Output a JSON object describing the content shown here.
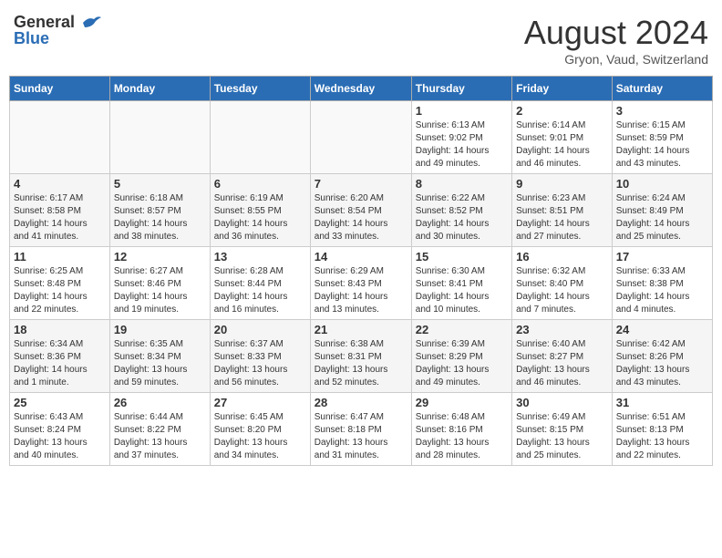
{
  "header": {
    "logo_general": "General",
    "logo_blue": "Blue",
    "title": "August 2024",
    "location": "Gryon, Vaud, Switzerland"
  },
  "weekdays": [
    "Sunday",
    "Monday",
    "Tuesday",
    "Wednesday",
    "Thursday",
    "Friday",
    "Saturday"
  ],
  "weeks": [
    [
      {
        "day": "",
        "info": ""
      },
      {
        "day": "",
        "info": ""
      },
      {
        "day": "",
        "info": ""
      },
      {
        "day": "",
        "info": ""
      },
      {
        "day": "1",
        "info": "Sunrise: 6:13 AM\nSunset: 9:02 PM\nDaylight: 14 hours\nand 49 minutes."
      },
      {
        "day": "2",
        "info": "Sunrise: 6:14 AM\nSunset: 9:01 PM\nDaylight: 14 hours\nand 46 minutes."
      },
      {
        "day": "3",
        "info": "Sunrise: 6:15 AM\nSunset: 8:59 PM\nDaylight: 14 hours\nand 43 minutes."
      }
    ],
    [
      {
        "day": "4",
        "info": "Sunrise: 6:17 AM\nSunset: 8:58 PM\nDaylight: 14 hours\nand 41 minutes."
      },
      {
        "day": "5",
        "info": "Sunrise: 6:18 AM\nSunset: 8:57 PM\nDaylight: 14 hours\nand 38 minutes."
      },
      {
        "day": "6",
        "info": "Sunrise: 6:19 AM\nSunset: 8:55 PM\nDaylight: 14 hours\nand 36 minutes."
      },
      {
        "day": "7",
        "info": "Sunrise: 6:20 AM\nSunset: 8:54 PM\nDaylight: 14 hours\nand 33 minutes."
      },
      {
        "day": "8",
        "info": "Sunrise: 6:22 AM\nSunset: 8:52 PM\nDaylight: 14 hours\nand 30 minutes."
      },
      {
        "day": "9",
        "info": "Sunrise: 6:23 AM\nSunset: 8:51 PM\nDaylight: 14 hours\nand 27 minutes."
      },
      {
        "day": "10",
        "info": "Sunrise: 6:24 AM\nSunset: 8:49 PM\nDaylight: 14 hours\nand 25 minutes."
      }
    ],
    [
      {
        "day": "11",
        "info": "Sunrise: 6:25 AM\nSunset: 8:48 PM\nDaylight: 14 hours\nand 22 minutes."
      },
      {
        "day": "12",
        "info": "Sunrise: 6:27 AM\nSunset: 8:46 PM\nDaylight: 14 hours\nand 19 minutes."
      },
      {
        "day": "13",
        "info": "Sunrise: 6:28 AM\nSunset: 8:44 PM\nDaylight: 14 hours\nand 16 minutes."
      },
      {
        "day": "14",
        "info": "Sunrise: 6:29 AM\nSunset: 8:43 PM\nDaylight: 14 hours\nand 13 minutes."
      },
      {
        "day": "15",
        "info": "Sunrise: 6:30 AM\nSunset: 8:41 PM\nDaylight: 14 hours\nand 10 minutes."
      },
      {
        "day": "16",
        "info": "Sunrise: 6:32 AM\nSunset: 8:40 PM\nDaylight: 14 hours\nand 7 minutes."
      },
      {
        "day": "17",
        "info": "Sunrise: 6:33 AM\nSunset: 8:38 PM\nDaylight: 14 hours\nand 4 minutes."
      }
    ],
    [
      {
        "day": "18",
        "info": "Sunrise: 6:34 AM\nSunset: 8:36 PM\nDaylight: 14 hours\nand 1 minute."
      },
      {
        "day": "19",
        "info": "Sunrise: 6:35 AM\nSunset: 8:34 PM\nDaylight: 13 hours\nand 59 minutes."
      },
      {
        "day": "20",
        "info": "Sunrise: 6:37 AM\nSunset: 8:33 PM\nDaylight: 13 hours\nand 56 minutes."
      },
      {
        "day": "21",
        "info": "Sunrise: 6:38 AM\nSunset: 8:31 PM\nDaylight: 13 hours\nand 52 minutes."
      },
      {
        "day": "22",
        "info": "Sunrise: 6:39 AM\nSunset: 8:29 PM\nDaylight: 13 hours\nand 49 minutes."
      },
      {
        "day": "23",
        "info": "Sunrise: 6:40 AM\nSunset: 8:27 PM\nDaylight: 13 hours\nand 46 minutes."
      },
      {
        "day": "24",
        "info": "Sunrise: 6:42 AM\nSunset: 8:26 PM\nDaylight: 13 hours\nand 43 minutes."
      }
    ],
    [
      {
        "day": "25",
        "info": "Sunrise: 6:43 AM\nSunset: 8:24 PM\nDaylight: 13 hours\nand 40 minutes."
      },
      {
        "day": "26",
        "info": "Sunrise: 6:44 AM\nSunset: 8:22 PM\nDaylight: 13 hours\nand 37 minutes."
      },
      {
        "day": "27",
        "info": "Sunrise: 6:45 AM\nSunset: 8:20 PM\nDaylight: 13 hours\nand 34 minutes."
      },
      {
        "day": "28",
        "info": "Sunrise: 6:47 AM\nSunset: 8:18 PM\nDaylight: 13 hours\nand 31 minutes."
      },
      {
        "day": "29",
        "info": "Sunrise: 6:48 AM\nSunset: 8:16 PM\nDaylight: 13 hours\nand 28 minutes."
      },
      {
        "day": "30",
        "info": "Sunrise: 6:49 AM\nSunset: 8:15 PM\nDaylight: 13 hours\nand 25 minutes."
      },
      {
        "day": "31",
        "info": "Sunrise: 6:51 AM\nSunset: 8:13 PM\nDaylight: 13 hours\nand 22 minutes."
      }
    ]
  ]
}
